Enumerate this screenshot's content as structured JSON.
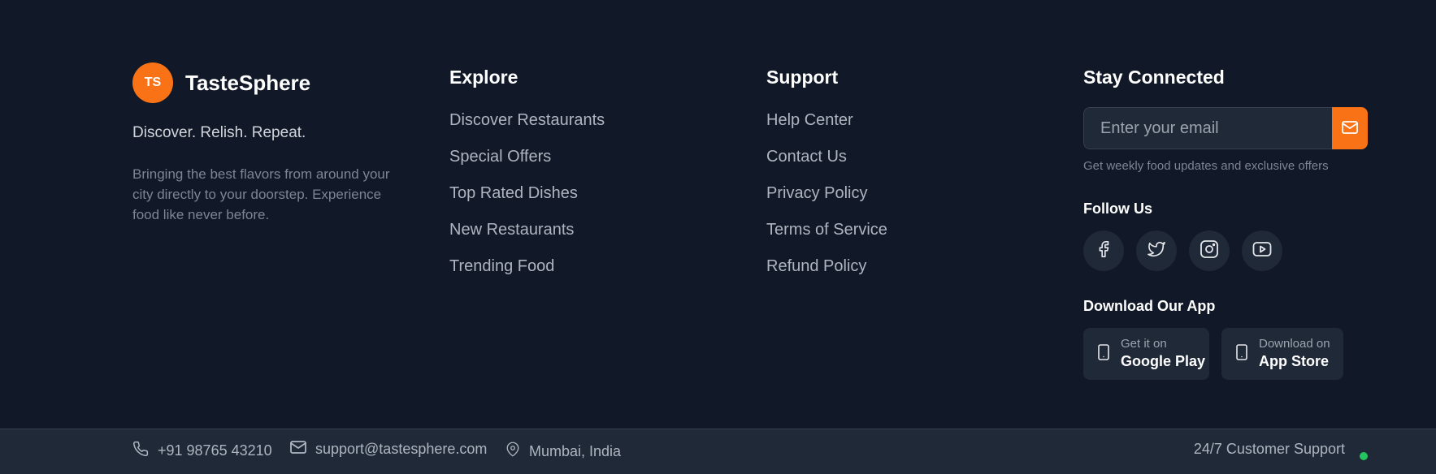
{
  "brand": {
    "logo_text": "TS",
    "name": "TasteSphere",
    "tagline": "Discover. Relish. Repeat.",
    "description": "Bringing the best flavors from around your city directly to your doorstep. Experience food like never before."
  },
  "explore": {
    "title": "Explore",
    "links": [
      "Discover Restaurants",
      "Special Offers",
      "Top Rated Dishes",
      "New Restaurants",
      "Trending Food"
    ]
  },
  "support": {
    "title": "Support",
    "links": [
      "Help Center",
      "Contact Us",
      "Privacy Policy",
      "Terms of Service",
      "Refund Policy"
    ]
  },
  "connect": {
    "title": "Stay Connected",
    "email_placeholder": "Enter your email",
    "email_note": "Get weekly food updates and exclusive offers",
    "follow_title": "Follow Us",
    "social_icons": [
      "facebook-icon",
      "twitter-icon",
      "instagram-icon",
      "youtube-icon"
    ],
    "app_title": "Download Our App",
    "apps": [
      {
        "small": "Get it on",
        "big": "Google Play",
        "icon": "smartphone-icon"
      },
      {
        "small": "Download on",
        "big": "App Store",
        "icon": "smartphone-icon"
      }
    ]
  },
  "bottom": {
    "phone": "+91 98765 43210",
    "email": "support@tastesphere.com",
    "location": "Mumbai, India",
    "support": "24/7 Customer Support",
    "status_color": "#22c55e"
  },
  "colors": {
    "accent": "#f97316",
    "background": "#111827",
    "surface": "#1f2937"
  }
}
